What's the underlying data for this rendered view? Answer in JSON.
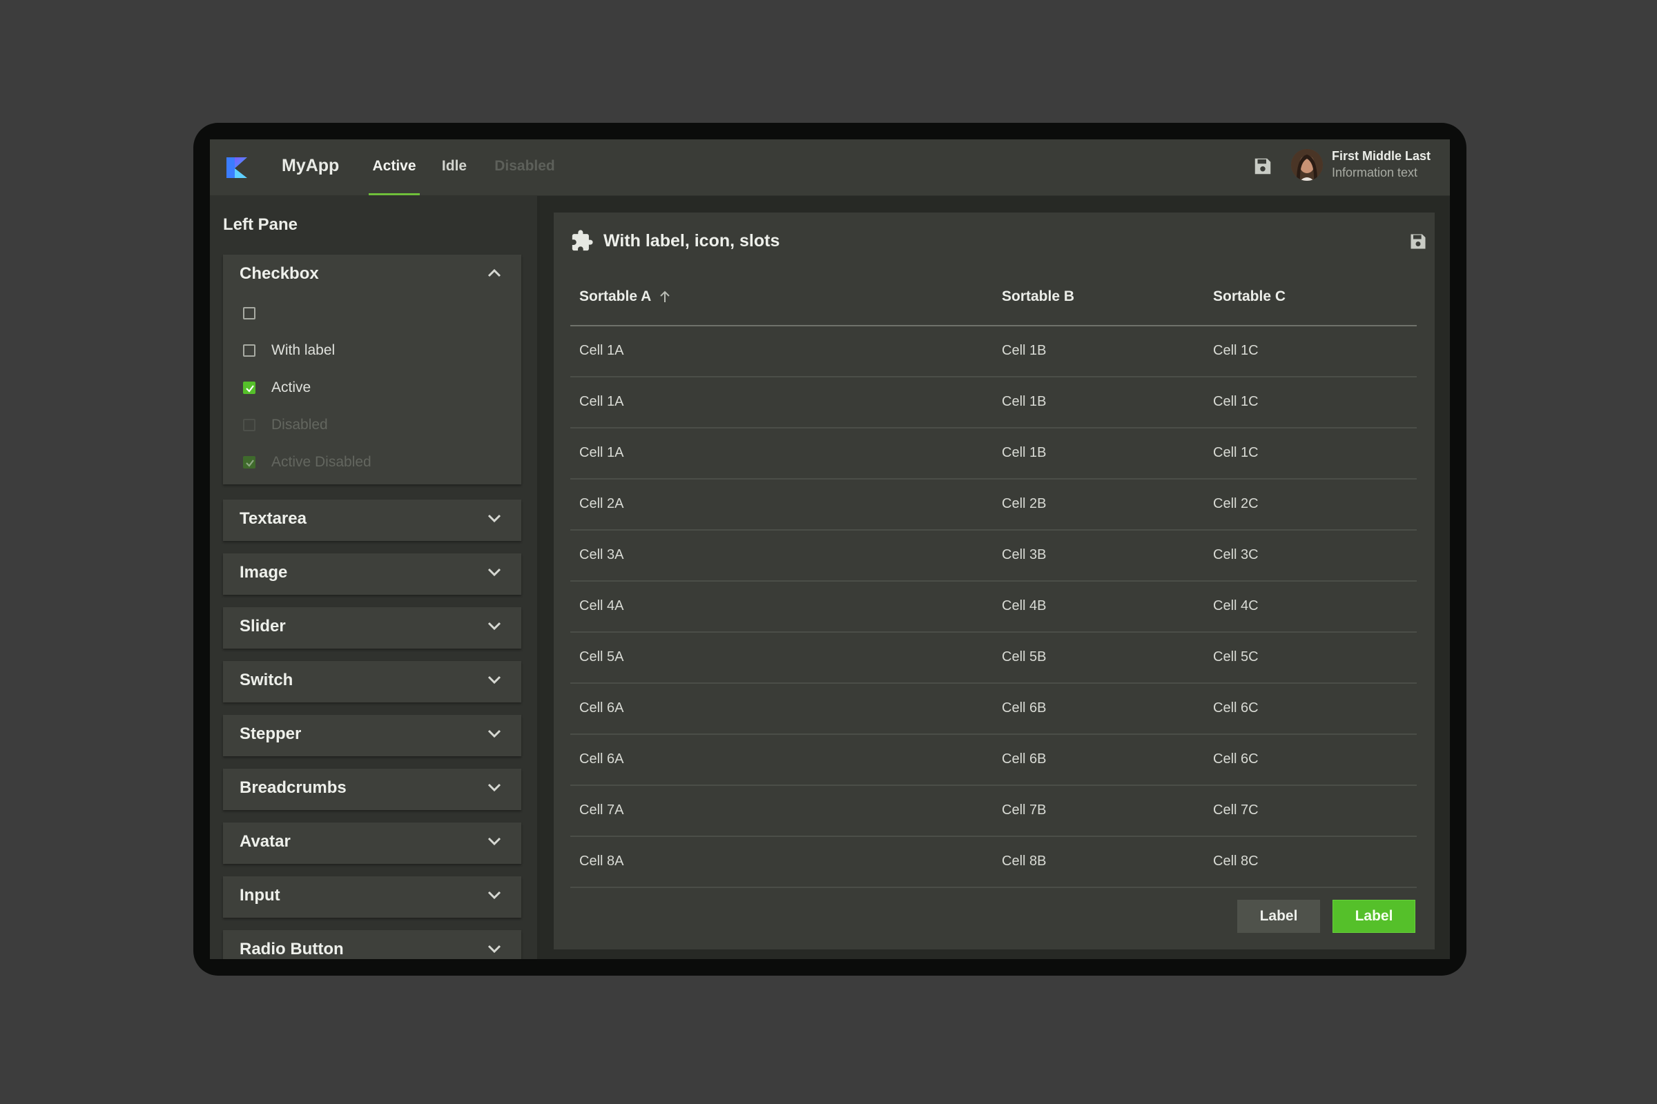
{
  "header": {
    "app_name": "MyApp",
    "tabs": [
      {
        "label": "Active",
        "state": "active"
      },
      {
        "label": "Idle",
        "state": "idle"
      },
      {
        "label": "Disabled",
        "state": "disabled"
      }
    ],
    "user": {
      "name": "First Middle Last",
      "info": "Information text"
    },
    "icons": {
      "logo": "app-logo-icon",
      "save": "save-icon"
    }
  },
  "left_pane": {
    "title": "Left Pane",
    "accordions": [
      {
        "title": "Checkbox",
        "expanded": true
      },
      {
        "title": "Textarea",
        "expanded": false
      },
      {
        "title": "Image",
        "expanded": false
      },
      {
        "title": "Slider",
        "expanded": false
      },
      {
        "title": "Switch",
        "expanded": false
      },
      {
        "title": "Stepper",
        "expanded": false
      },
      {
        "title": "Breadcrumbs",
        "expanded": false
      },
      {
        "title": "Avatar",
        "expanded": false
      },
      {
        "title": "Input",
        "expanded": false
      },
      {
        "title": "Radio Button",
        "expanded": false
      }
    ],
    "checkboxes": [
      {
        "label": "",
        "checked": false,
        "disabled": false
      },
      {
        "label": "With label",
        "checked": false,
        "disabled": false
      },
      {
        "label": "Active",
        "checked": true,
        "disabled": false
      },
      {
        "label": "Disabled",
        "checked": false,
        "disabled": true
      },
      {
        "label": "Active Disabled",
        "checked": true,
        "disabled": true
      }
    ]
  },
  "card": {
    "title": "With label, icon, slots",
    "icons": {
      "title": "puzzle-icon",
      "action": "save-icon"
    },
    "table": {
      "columns": [
        "Sortable A",
        "Sortable B",
        "Sortable C"
      ],
      "sorted_column": "Sortable A",
      "sort_direction": "ascending",
      "rows": [
        [
          "Cell 1A",
          "Cell 1B",
          "Cell 1C"
        ],
        [
          "Cell 1A",
          "Cell 1B",
          "Cell 1C"
        ],
        [
          "Cell 1A",
          "Cell 1B",
          "Cell 1C"
        ],
        [
          "Cell 2A",
          "Cell 2B",
          "Cell 2C"
        ],
        [
          "Cell 3A",
          "Cell 3B",
          "Cell 3C"
        ],
        [
          "Cell 4A",
          "Cell 4B",
          "Cell 4C"
        ],
        [
          "Cell 5A",
          "Cell 5B",
          "Cell 5C"
        ],
        [
          "Cell 6A",
          "Cell 6B",
          "Cell 6C"
        ],
        [
          "Cell 6A",
          "Cell 6B",
          "Cell 6C"
        ],
        [
          "Cell 7A",
          "Cell 7B",
          "Cell 7C"
        ],
        [
          "Cell 8A",
          "Cell 8B",
          "Cell 8C"
        ]
      ]
    },
    "buttons": {
      "secondary": "Label",
      "primary": "Label"
    }
  },
  "colors": {
    "accent": "#55c02a",
    "background": "#3d3d3d",
    "surface": "#3a3c37",
    "pane": "#30322e"
  }
}
